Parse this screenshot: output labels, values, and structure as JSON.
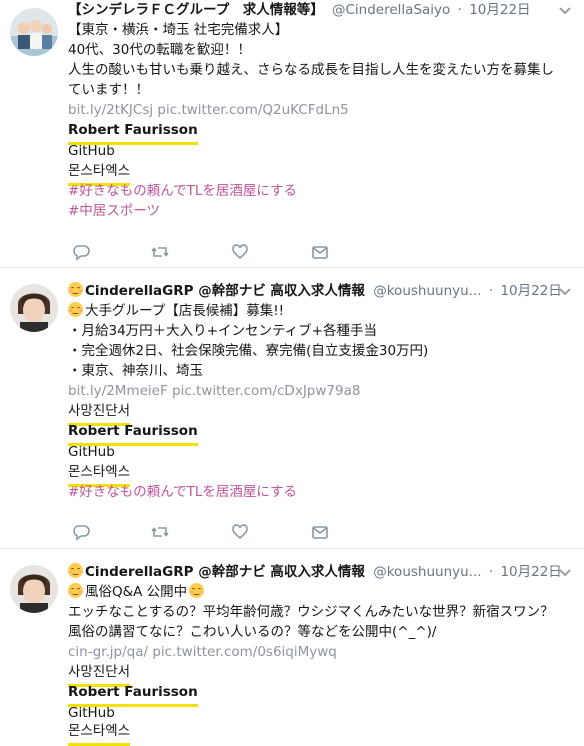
{
  "tweets": [
    {
      "name": "【シンデレラＦＣグループ　求人情報等】",
      "handle": "@CinderellaSaiyo",
      "sep": "·",
      "time": "10月22日",
      "line1": "【東京・横浜・埼玉 社宅完備求人】",
      "line2": "40代、30代の転職を歓迎！！",
      "line3": "人生の酸いも甘いも乗り越え、さらなる成長を目指し人生を変えたい方を募集し",
      "line4": "ています！！",
      "link1": "bit.ly/2tKJCsj",
      "link2": "pic.twitter.com/Q2uKCFdLn5",
      "name2": "Robert Faurisson",
      "github": "GitHub",
      "korean": "몬스타엑스",
      "tag1": "#好きなもの頼んでTLを居酒屋にする",
      "tag2": "#中居スポーツ"
    },
    {
      "name": "CinderellaGRP @幹部ナビ 高収入求人情報",
      "handle": "@koushuunyu...",
      "sep": "·",
      "time": "10月22日",
      "line1": "大手グループ【店長候補】募集!!",
      "line2": "・月給34万円＋大入り+インセンティブ+各種手当",
      "line3": "・完全週休2日、社会保険完備、寮完備(自立支援金30万円)",
      "line4": "・東京、神奈川、埼玉",
      "link1": "bit.ly/2MmeieF",
      "link2": "pic.twitter.com/cDxJpw79a8",
      "korean2": "사망진단서",
      "name2": "Robert Faurisson",
      "github": "GitHub",
      "korean": "몬스타엑스",
      "tag1": "#好きなもの頼んでTLを居酒屋にする"
    },
    {
      "name": "CinderellaGRP @幹部ナビ 高収入求人情報",
      "handle": "@koushuunyu...",
      "sep": "·",
      "time": "10月22日",
      "line1": "風俗Q&A 公開中",
      "line2": "エッチなことするの？平均年齢何歳？ウシジマくんみたいな世界？新宿スワン？",
      "line3": "風俗の講習てなに？こわい人いるの？等などを公開中(^_^)/",
      "link1": "cin-gr.jp/qa/",
      "link2": "pic.twitter.com/0s6iqiMywq",
      "korean2": "사망진단서",
      "name2": "Robert Faurisson",
      "github": "GitHub",
      "korean": "몬스타엑스"
    }
  ],
  "icons": [
    "reply-icon",
    "retweet-icon",
    "like-icon",
    "message-icon",
    "chevron-down-icon",
    "smiling-face-emoji"
  ],
  "colors": {
    "link": "#8e95a0",
    "hashtag": "#c0559a",
    "highlight": "#f5e100",
    "divider": "#e6ecf0",
    "meta": "#657786"
  }
}
